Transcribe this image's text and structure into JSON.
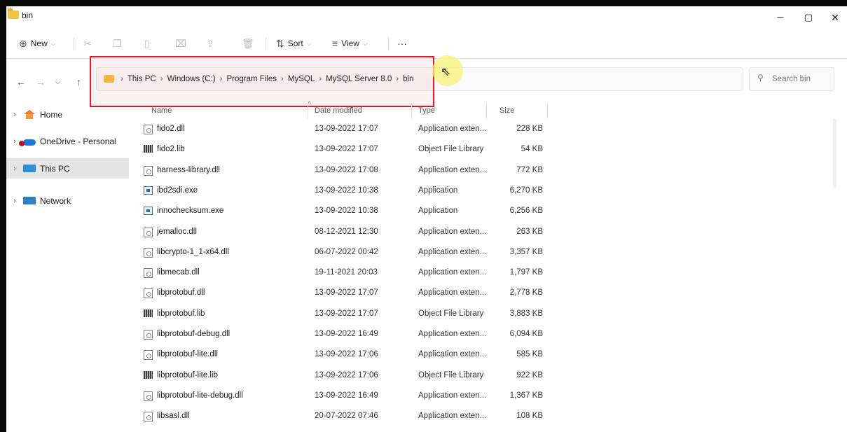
{
  "window": {
    "title": "bin",
    "controls": {
      "minimize": "–",
      "maximize": "▢",
      "close": "✕"
    }
  },
  "toolbar": {
    "new_label": "New",
    "sort_label": "Sort",
    "view_label": "View",
    "more_label": "···"
  },
  "address": {
    "crumbs": [
      "This PC",
      "Windows (C:)",
      "Program Files",
      "MySQL",
      "MySQL Server 8.0",
      "bin"
    ],
    "search_placeholder": "Search bin"
  },
  "sidebar": {
    "items": [
      {
        "label": "Home"
      },
      {
        "label": "OneDrive - Personal"
      },
      {
        "label": "This PC"
      },
      {
        "label": "Network"
      }
    ]
  },
  "columns": {
    "name": "Name",
    "date": "Date modified",
    "type": "Type",
    "size": "Size"
  },
  "files": [
    {
      "name": "fido2.dll",
      "date": "13-09-2022 17:07",
      "type": "Application exten...",
      "size": "228 KB",
      "icon": "dll"
    },
    {
      "name": "fido2.lib",
      "date": "13-09-2022 17:07",
      "type": "Object File Library",
      "size": "54 KB",
      "icon": "lib"
    },
    {
      "name": "harness-library.dll",
      "date": "13-09-2022 17:08",
      "type": "Application exten...",
      "size": "772 KB",
      "icon": "dll"
    },
    {
      "name": "ibd2sdi.exe",
      "date": "13-09-2022 10:38",
      "type": "Application",
      "size": "6,270 KB",
      "icon": "exe"
    },
    {
      "name": "innochecksum.exe",
      "date": "13-09-2022 10:38",
      "type": "Application",
      "size": "6,256 KB",
      "icon": "exe"
    },
    {
      "name": "jemalloc.dll",
      "date": "08-12-2021 12:30",
      "type": "Application exten...",
      "size": "263 KB",
      "icon": "dll"
    },
    {
      "name": "libcrypto-1_1-x64.dll",
      "date": "06-07-2022 00:42",
      "type": "Application exten...",
      "size": "3,357 KB",
      "icon": "dll"
    },
    {
      "name": "libmecab.dll",
      "date": "19-11-2021 20:03",
      "type": "Application exten...",
      "size": "1,797 KB",
      "icon": "dll"
    },
    {
      "name": "libprotobuf.dll",
      "date": "13-09-2022 17:07",
      "type": "Application exten...",
      "size": "2,778 KB",
      "icon": "dll"
    },
    {
      "name": "libprotobuf.lib",
      "date": "13-09-2022 17:07",
      "type": "Object File Library",
      "size": "3,883 KB",
      "icon": "lib"
    },
    {
      "name": "libprotobuf-debug.dll",
      "date": "13-09-2022 16:49",
      "type": "Application exten...",
      "size": "6,094 KB",
      "icon": "dll"
    },
    {
      "name": "libprotobuf-lite.dll",
      "date": "13-09-2022 17:06",
      "type": "Application exten...",
      "size": "585 KB",
      "icon": "dll"
    },
    {
      "name": "libprotobuf-lite.lib",
      "date": "13-09-2022 17:06",
      "type": "Object File Library",
      "size": "922 KB",
      "icon": "lib"
    },
    {
      "name": "libprotobuf-lite-debug.dll",
      "date": "13-09-2022 16:49",
      "type": "Application exten...",
      "size": "1,367 KB",
      "icon": "dll"
    },
    {
      "name": "libsasl.dll",
      "date": "20-07-2022 07:46",
      "type": "Application exten...",
      "size": "108 KB",
      "icon": "dll"
    }
  ],
  "colors": {
    "highlight_border": "#e0182e",
    "folder": "#f2c341",
    "selected_bg": "#e5e5e5"
  }
}
